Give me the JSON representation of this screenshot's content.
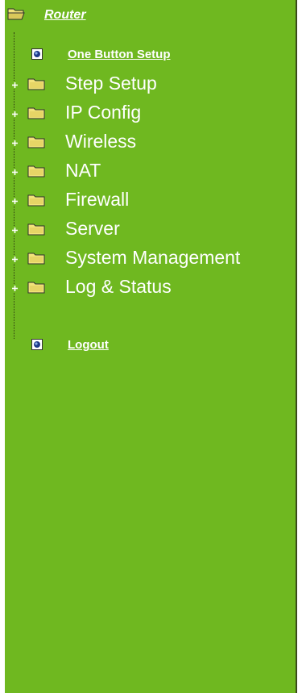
{
  "tree": {
    "root_label": "Router",
    "one_button_setup": "One Button Setup",
    "folders": [
      {
        "label": "Step Setup"
      },
      {
        "label": "IP Config"
      },
      {
        "label": "Wireless"
      },
      {
        "label": "NAT"
      },
      {
        "label": "Firewall"
      },
      {
        "label": "Server"
      },
      {
        "label": "System Management"
      },
      {
        "label": "Log & Status"
      }
    ],
    "logout": "Logout"
  },
  "colors": {
    "panel_bg": "#6fb820",
    "text": "#ffffff",
    "folder": "#f2e37a"
  }
}
